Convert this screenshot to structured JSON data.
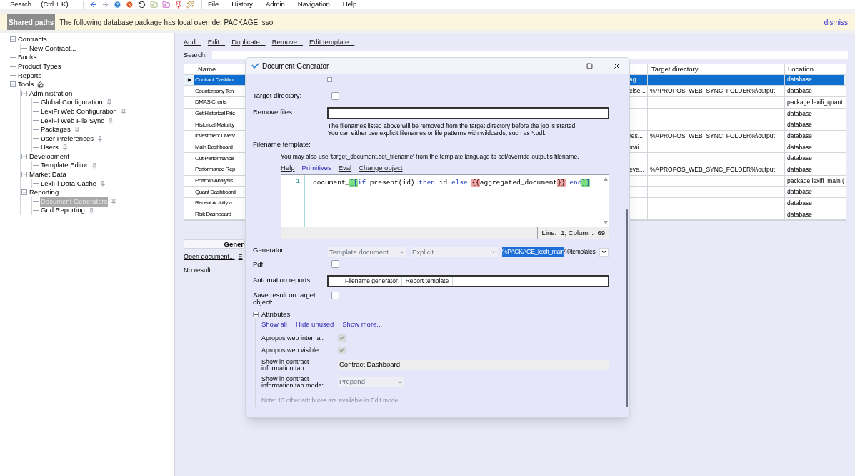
{
  "toolbar": {
    "search": "Search ... (Ctrl + K)"
  },
  "menu": [
    "File",
    "History",
    "Admin",
    "Navigation",
    "Help"
  ],
  "banner": {
    "label": "Shared paths",
    "message": "The following database package has local override: PACKAGE_sso",
    "action": "dismiss"
  },
  "tree": [
    {
      "label": "Contracts",
      "expanded": true,
      "selected": false,
      "children": [
        {
          "label": "New Contract...",
          "selected": false
        }
      ]
    },
    {
      "label": "Books",
      "selected": false
    },
    {
      "label": "Product Types",
      "selected": false
    },
    {
      "label": "Reports",
      "selected": false
    },
    {
      "label": "Tools",
      "expanded": true,
      "selected": false,
      "kind": "home",
      "children": [
        {
          "label": "Administration",
          "expanded": true,
          "selected": false,
          "children": [
            {
              "label": "Global Configuration",
              "pinned": true,
              "selected": false
            },
            {
              "label": "LexiFi Web Configuration",
              "pinned": true,
              "selected": false
            },
            {
              "label": "LexiFi Web File Sync",
              "pinned": true,
              "selected": false
            },
            {
              "label": "Packages",
              "pinned": true,
              "selected": false
            },
            {
              "label": "User Preferences",
              "pinned": true,
              "selected": false
            },
            {
              "label": "Users",
              "pinned": true,
              "selected": false
            }
          ]
        },
        {
          "label": "Development",
          "expanded": true,
          "selected": false,
          "children": [
            {
              "label": "Template Editor",
              "pinned": true,
              "selected": false
            }
          ]
        },
        {
          "label": "Market Data",
          "expanded": true,
          "selected": false,
          "children": [
            {
              "label": "LexiFi Data Cache",
              "pinned": true,
              "selected": false
            }
          ]
        },
        {
          "label": "Reporting",
          "expanded": true,
          "selected": false,
          "children": [
            {
              "label": "Document Generators",
              "pinned": true,
              "selected": true
            },
            {
              "label": "Grid Reporting",
              "pinned": true,
              "selected": false
            }
          ]
        }
      ]
    }
  ],
  "actions": [
    "Add...",
    "Edit...",
    "Duplicate...",
    "Remove...",
    "Edit template..."
  ],
  "search": {
    "label": "Search:"
  },
  "table": {
    "columns": [
      "Name",
      "Target directory",
      "Location"
    ],
    "rows": [
      {
        "name": "Contract Dashbo",
        "column_2": "ag...",
        "location": "database",
        "selected": true
      },
      {
        "name": "Counterparty Ten",
        "column_2": "else...",
        "target_directory": "%APROPOS_WEB_SYNC_FOLDER%\\output",
        "location": "database",
        "selected": false
      },
      {
        "name": "DMAS Charts",
        "location": "package lexifi_quant",
        "selected": false
      },
      {
        "name": "Get Historical Pric",
        "location": "database",
        "selected": false
      },
      {
        "name": "Historical Maturity",
        "location": "database",
        "selected": false
      },
      {
        "name": "Investment Overv",
        "column_2": "res...",
        "target_directory": "%APROPOS_WEB_SYNC_FOLDER%\\output",
        "location": "database",
        "selected": false
      },
      {
        "name": "Main Dashboard",
        "column_2": "mai...",
        "location": "database",
        "selected": false
      },
      {
        "name": "Out Performance",
        "location": "database",
        "selected": false
      },
      {
        "name": "Performance Rep",
        "column_2": "eve...",
        "target_directory": "%APROPOS_WEB_SYNC_FOLDER%\\output",
        "location": "database",
        "selected": false
      },
      {
        "name": "Portfolio Analysis",
        "location": "package lexifi_main (",
        "selected": false
      },
      {
        "name": "Quant Dashboard",
        "location": "database",
        "selected": false
      },
      {
        "name": "Recent Activity a",
        "location": "database",
        "selected": false
      },
      {
        "name": "Risk Dashboard",
        "location": "database",
        "selected": false
      }
    ]
  },
  "generate_button": "Gener",
  "links": [
    "Open document...",
    "E"
  ],
  "result": "No result.",
  "dialog": {
    "title": "Document Generator",
    "target_directory": {
      "label": "Target directory:",
      "checked": false
    },
    "remove_files": {
      "label": "Remove files:",
      "hint_1": "The filenames listed above will be removed from the target directory before the job is started.",
      "hint_2": "You can either use explicit filenames or file patterns with wildcards, such as *.pdf."
    },
    "filename_template": {
      "label": "Filename template:",
      "hint": "You may also use 'target_document.set_filename' from the template language to set/override output's filename.",
      "links": [
        "Help",
        "Primitives",
        "Eval",
        "Change object"
      ],
      "line_number": "1",
      "code": [
        {
          "kind": "plain",
          "text": "document_"
        },
        {
          "kind": "bracket",
          "text": "[["
        },
        {
          "kind": "keyword",
          "text": "if"
        },
        {
          "kind": "plain",
          "text": " present(id) "
        },
        {
          "kind": "keyword",
          "text": "then"
        },
        {
          "kind": "plain",
          "text": " id "
        },
        {
          "kind": "keyword",
          "text": "else "
        },
        {
          "kind": "brace",
          "text": "{{"
        },
        {
          "kind": "plain",
          "text": "aggregated_document"
        },
        {
          "kind": "brace",
          "text": "}}"
        },
        {
          "kind": "keyword",
          "text": " end"
        },
        {
          "kind": "bracket",
          "text": "]]"
        }
      ],
      "status_label": "Line:",
      "status_value": "1; Column:  69"
    },
    "generator": {
      "label": "Generator:",
      "type": "Template document",
      "mode": "Explicit",
      "path_selected": "%PACKAGE_lexifi_main",
      "path_rest": "%\\templates"
    },
    "pdf": {
      "label": "Pdf:",
      "checked": false
    },
    "automation_reports": {
      "label": "Automation reports:",
      "columns": [
        "Filename generator",
        "Report template"
      ]
    },
    "save_result": {
      "label": "Save result on target object:",
      "checked": false
    },
    "attributes": {
      "label": "Attributes",
      "expanded": true,
      "links": [
        "Show all",
        "Hide unused",
        "Show more..."
      ],
      "items": [
        {
          "kind": "checkbox",
          "label": "Apropos web internal:",
          "checked": true
        },
        {
          "kind": "checkbox",
          "label": "Apropos web visible:",
          "checked": true
        },
        {
          "kind": "text",
          "label": "Show in contract information tab:",
          "value": "Contract Dashboard"
        },
        {
          "kind": "select",
          "label": "Show in contract information tab mode:",
          "value": "Prepend"
        }
      ],
      "note": "Note: 13 other attributes are available in Edit mode."
    }
  }
}
